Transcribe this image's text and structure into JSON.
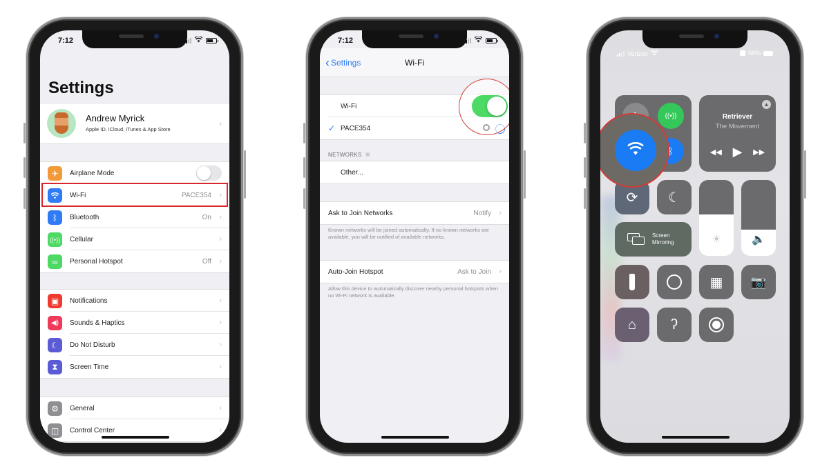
{
  "phone1": {
    "status": {
      "time": "7:12"
    },
    "title": "Settings",
    "profile": {
      "name": "Andrew Myrick",
      "subtitle": "Apple ID, iCloud, iTunes & App Store",
      "avatar_icon": "memoji-avatar"
    },
    "group1": [
      {
        "label": "Airplane Mode",
        "value": "",
        "icon": "airplane-icon",
        "color": "#f19a37",
        "toggle": true,
        "toggle_on": false
      },
      {
        "label": "Wi-Fi",
        "value": "PACE354",
        "icon": "wifi-icon",
        "color": "#2f7cf6",
        "highlighted": true
      },
      {
        "label": "Bluetooth",
        "value": "On",
        "icon": "bluetooth-icon",
        "color": "#2f7cf6"
      },
      {
        "label": "Cellular",
        "value": "",
        "icon": "cellular-icon",
        "color": "#4cd964"
      },
      {
        "label": "Personal Hotspot",
        "value": "Off",
        "icon": "hotspot-icon",
        "color": "#4cd964"
      }
    ],
    "group2": [
      {
        "label": "Notifications",
        "icon": "notifications-icon",
        "color": "#f03a30"
      },
      {
        "label": "Sounds & Haptics",
        "icon": "sounds-icon",
        "color": "#f03a5a"
      },
      {
        "label": "Do Not Disturb",
        "icon": "moon-icon",
        "color": "#5b5bd6"
      },
      {
        "label": "Screen Time",
        "icon": "hourglass-icon",
        "color": "#5b5bd6"
      }
    ],
    "group3": [
      {
        "label": "General",
        "icon": "gear-icon",
        "color": "#8e8e93"
      },
      {
        "label": "Control Center",
        "icon": "switches-icon",
        "color": "#8e8e93"
      }
    ]
  },
  "phone2": {
    "status": {
      "time": "7:12"
    },
    "nav": {
      "back_label": "Settings",
      "title": "Wi-Fi"
    },
    "wifi_label": "Wi-Fi",
    "wifi_on": true,
    "connected_network": "PACE354",
    "networks_header": "NETWORKS",
    "other_label": "Other...",
    "ask_to_join": {
      "label": "Ask to Join Networks",
      "value": "Notify",
      "footer": "Known networks will be joined automatically. If no known networks are available, you will be notified of available networks."
    },
    "auto_join": {
      "label": "Auto-Join Hotspot",
      "value": "Ask to Join",
      "footer": "Allow this device to automatically discover nearby personal hotspots when no Wi-Fi network is available."
    },
    "toggle_color": "#4cd964"
  },
  "phone3": {
    "status": {
      "carrier": "Verizon",
      "battery": "56%"
    },
    "now_playing": {
      "title": "Retriever",
      "artist": "The Movement"
    },
    "screen_mirroring": {
      "line1": "Screen",
      "line2": "Mirroring"
    },
    "brightness_level": 0.55,
    "volume_level": 0.35,
    "colors": {
      "wifi_active": "#1a7cf5",
      "cellular_active": "#34c759",
      "tile": "#6b6b6d"
    }
  },
  "accent": {
    "highlight_red": "#d9262c"
  }
}
